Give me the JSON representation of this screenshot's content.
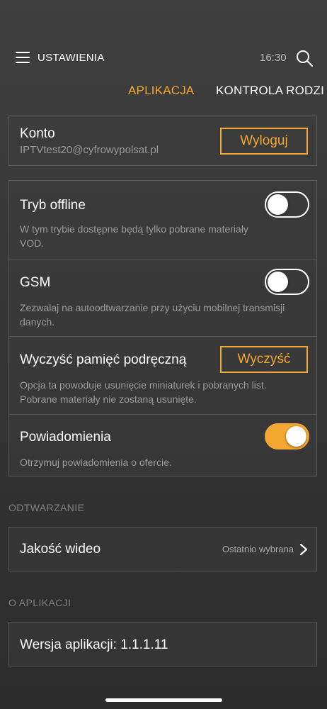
{
  "header": {
    "title": "USTAWIENIA",
    "time": "16:30"
  },
  "tabs": [
    {
      "label": "APLIKACJA",
      "active": true
    },
    {
      "label": "KONTROLA RODZI",
      "active": false
    }
  ],
  "account": {
    "title": "Konto",
    "email": "IPTVtest20@cyfrowypolsat.pl",
    "logout_label": "Wyloguj"
  },
  "settings": [
    {
      "title": "Tryb offline",
      "desc": "W tym trybie dostępne będą tylko pobrane materiały VOD.",
      "toggle": false
    },
    {
      "title": "GSM",
      "desc": "Zezwalaj na autoodtwarzanie przy użyciu mobilnej transmisji danych.",
      "toggle": false
    },
    {
      "title": "Wyczyść pamięć podręczną",
      "desc": "Opcja ta powoduje usunięcie miniaturek i pobranych list. Pobrane materiały nie zostaną usunięte.",
      "button": "Wyczyść"
    },
    {
      "title": "Powiadomienia",
      "desc": "Otrzymuj powiadomienia o ofercie.",
      "toggle": true
    }
  ],
  "playback": {
    "section": "ODTWARZANIE",
    "video_quality_label": "Jakość wideo",
    "video_quality_value": "Ostatnio wybrana"
  },
  "about": {
    "section": "O APLIKACJI",
    "version": "Wersja aplikacji: 1.1.1.11"
  },
  "colors": {
    "accent": "#f5a733",
    "background": "#363636",
    "muted_text": "#9a9a9a"
  },
  "icons": {
    "menu": "hamburger-menu-icon",
    "search": "search-icon",
    "chevron": "chevron-right-icon"
  }
}
